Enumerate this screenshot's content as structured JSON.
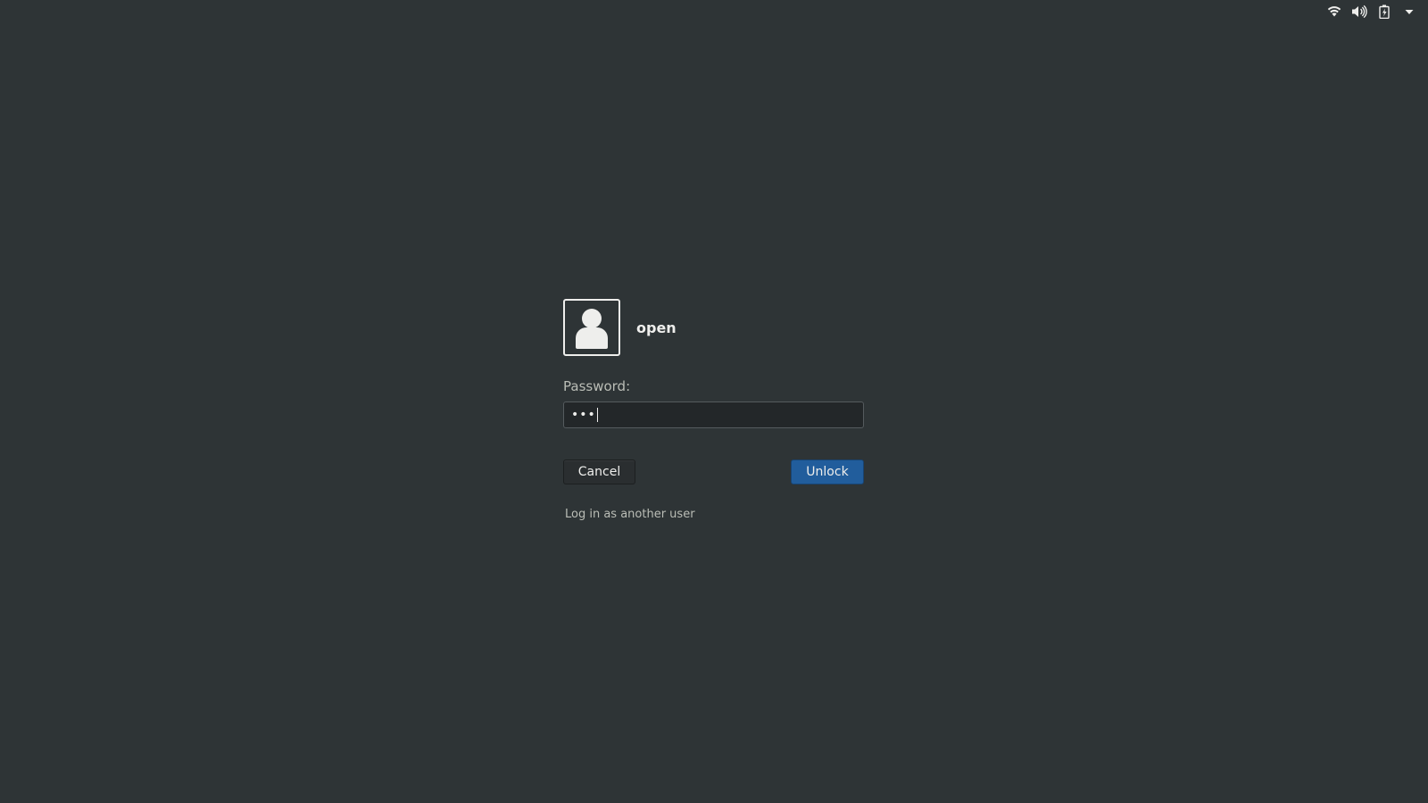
{
  "tray": {
    "icons": [
      "wifi-icon",
      "volume-icon",
      "battery-charging-icon",
      "dropdown-arrow-icon"
    ]
  },
  "login": {
    "avatar_icon": "user-avatar-icon",
    "username": "open",
    "password_label": "Password:",
    "password_value": "•••",
    "cancel_label": "Cancel",
    "unlock_label": "Unlock",
    "another_user_link": "Log in as another user"
  },
  "colors": {
    "background": "#2e3436",
    "accent": "#215d9c",
    "text": "#eeeeec",
    "muted_text": "#babdb6"
  }
}
